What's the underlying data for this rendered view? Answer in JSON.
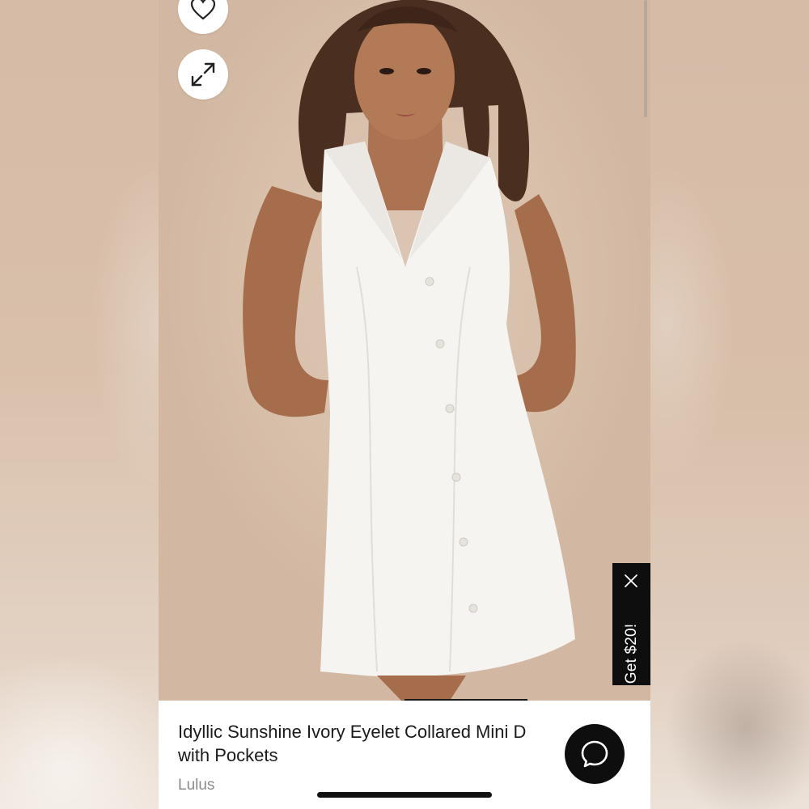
{
  "product": {
    "title_line1": "Idyllic Sunshine Ivory Eyelet Collared Mini D",
    "title_line2": "with Pockets",
    "brand": "Lulus"
  },
  "promo": {
    "label": "Get $20!",
    "close_icon": "close-icon"
  },
  "photo_actions": {
    "favorite_icon": "heart-icon",
    "expand_icon": "expand-icon"
  },
  "chat": {
    "icon": "chat-bubble-icon"
  },
  "colors": {
    "accent_dark": "#0e0e0e",
    "photo_background": "#d8c0ab",
    "brand_text": "#8a8a8a"
  }
}
